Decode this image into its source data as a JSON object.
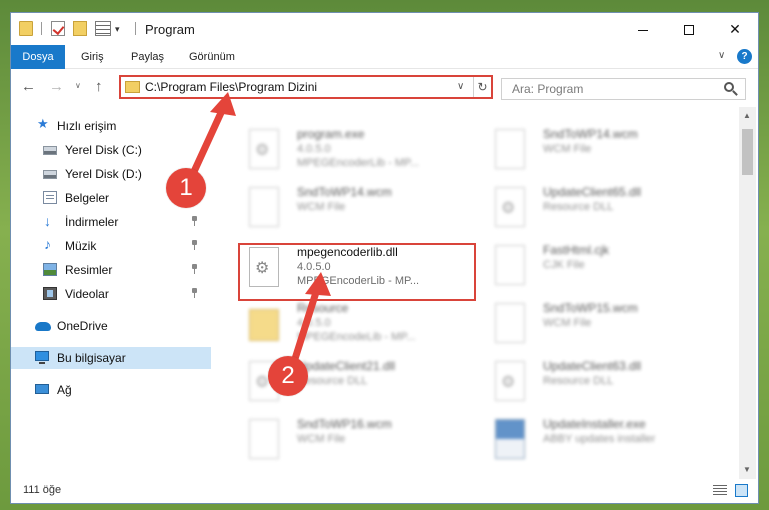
{
  "window": {
    "title": "Program",
    "controls": {
      "minimize": "",
      "maximize": "",
      "close": "✕"
    }
  },
  "ribbon": {
    "tabs": [
      "Dosya",
      "Giriş",
      "Paylaş",
      "Görünüm"
    ],
    "help": "?"
  },
  "address": {
    "path": "C:\\Program Files\\Program Dizini",
    "search_placeholder": "Ara: Program"
  },
  "sidebar": {
    "items": [
      {
        "label": "Hızlı erişim",
        "icon": "star-icon"
      },
      {
        "label": "Yerel Disk (C:)",
        "icon": "drive-icon"
      },
      {
        "label": "Yerel Disk (D:)",
        "icon": "drive-icon"
      },
      {
        "label": "Belgeler",
        "icon": "documents-icon",
        "pinned": true
      },
      {
        "label": "İndirmeler",
        "icon": "download-icon",
        "pinned": true
      },
      {
        "label": "Müzik",
        "icon": "music-icon",
        "pinned": true
      },
      {
        "label": "Resimler",
        "icon": "pictures-icon",
        "pinned": true
      },
      {
        "label": "Videolar",
        "icon": "videos-icon",
        "pinned": true
      },
      {
        "label": "OneDrive",
        "icon": "onedrive-icon"
      },
      {
        "label": "Bu bilgisayar",
        "icon": "computer-icon",
        "selected": true
      },
      {
        "label": "Ağ",
        "icon": "network-icon"
      }
    ]
  },
  "files": {
    "left": [
      {
        "name": "program.exe",
        "line1": "4.0.5.0",
        "line2": "MPEGEncoderLib - MP...",
        "icon": "exe"
      },
      {
        "name": "SndToWP14.wcm",
        "line1": "WCM File",
        "line2": "",
        "icon": "file"
      },
      {
        "name": "mpegencoderlib.dll",
        "line1": "4.0.5.0",
        "line2": "MPEGEncoderLib - MP...",
        "icon": "dll"
      },
      {
        "name": "Resource",
        "line1": "4.0.5.0",
        "line2": "MPEGEncodeLib - MP...",
        "icon": "folder"
      },
      {
        "name": "UpdateClient21.dll",
        "line1": "Resource DLL",
        "line2": "",
        "icon": "dll"
      },
      {
        "name": "SndToWP16.wcm",
        "line1": "WCM File",
        "line2": "",
        "icon": "file"
      }
    ],
    "right": [
      {
        "name": "SndToWP14.wcm",
        "line1": "WCM File",
        "line2": "",
        "icon": "file"
      },
      {
        "name": "UpdateClient65.dll",
        "line1": "Resource DLL",
        "line2": "",
        "icon": "dll"
      },
      {
        "name": "FastHtml.cjk",
        "line1": "CJK File",
        "line2": "",
        "icon": "file"
      },
      {
        "name": "SndToWP15.wcm",
        "line1": "WCM File",
        "line2": "",
        "icon": "file"
      },
      {
        "name": "UpdateClient63.dll",
        "line1": "Resource DLL",
        "line2": "",
        "icon": "dll"
      },
      {
        "name": "UpdateInstaller.exe",
        "line1": "ABBY updates installer",
        "line2": "",
        "icon": "installer"
      }
    ]
  },
  "highlighted": {
    "name": "mpegencoderlib.dll",
    "line1": "4.0.5.0",
    "line2": "MPEGEncoderLib - MP..."
  },
  "status": {
    "count": "111 öğe"
  },
  "callouts": [
    "1",
    "2"
  ],
  "colors": {
    "accent": "#1979ca",
    "highlight": "#d9443a",
    "callout": "#e4443a"
  }
}
